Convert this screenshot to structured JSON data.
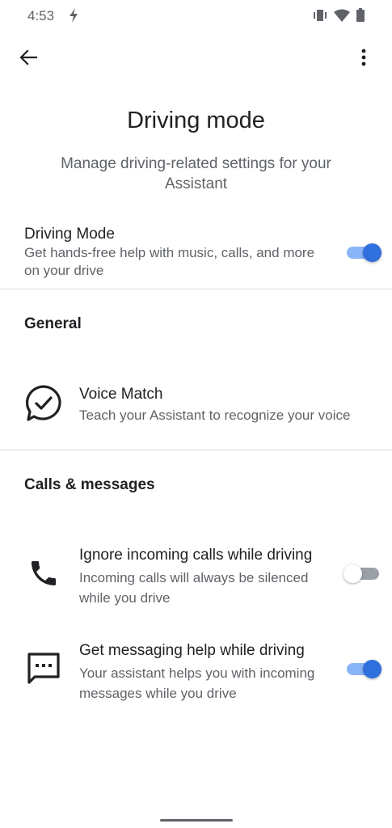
{
  "status_bar": {
    "time": "4:53",
    "icons": [
      "lightning-icon",
      "vibrate-icon",
      "wifi-icon",
      "battery-icon"
    ]
  },
  "toolbar": {
    "back_icon": "arrow-back-icon",
    "more_icon": "more-vert-icon"
  },
  "header": {
    "title": "Driving mode",
    "subtitle": "Manage driving-related settings for your Assistant"
  },
  "driving_mode": {
    "title": "Driving Mode",
    "summary": "Get hands-free help with music, calls, and more on your drive",
    "enabled": true
  },
  "sections": {
    "general": {
      "header": "General",
      "voice_match": {
        "icon": "voice-match-check-icon",
        "title": "Voice Match",
        "summary": "Teach your Assistant to recognize your voice"
      }
    },
    "calls_messages": {
      "header": "Calls & messages",
      "ignore_calls": {
        "icon": "phone-icon",
        "title": "Ignore incoming calls while driving",
        "summary": "Incoming calls will always be silenced while you drive",
        "enabled": false
      },
      "messaging_help": {
        "icon": "message-icon",
        "title": "Get messaging help while driving",
        "summary": "Your assistant helps you with incoming messages while you drive",
        "enabled": true
      }
    }
  },
  "colors": {
    "accent": "#2f6fde",
    "accent_track": "#8ab4f8",
    "text_primary": "#202124",
    "text_secondary": "#5f6368",
    "divider": "#dadce0"
  }
}
